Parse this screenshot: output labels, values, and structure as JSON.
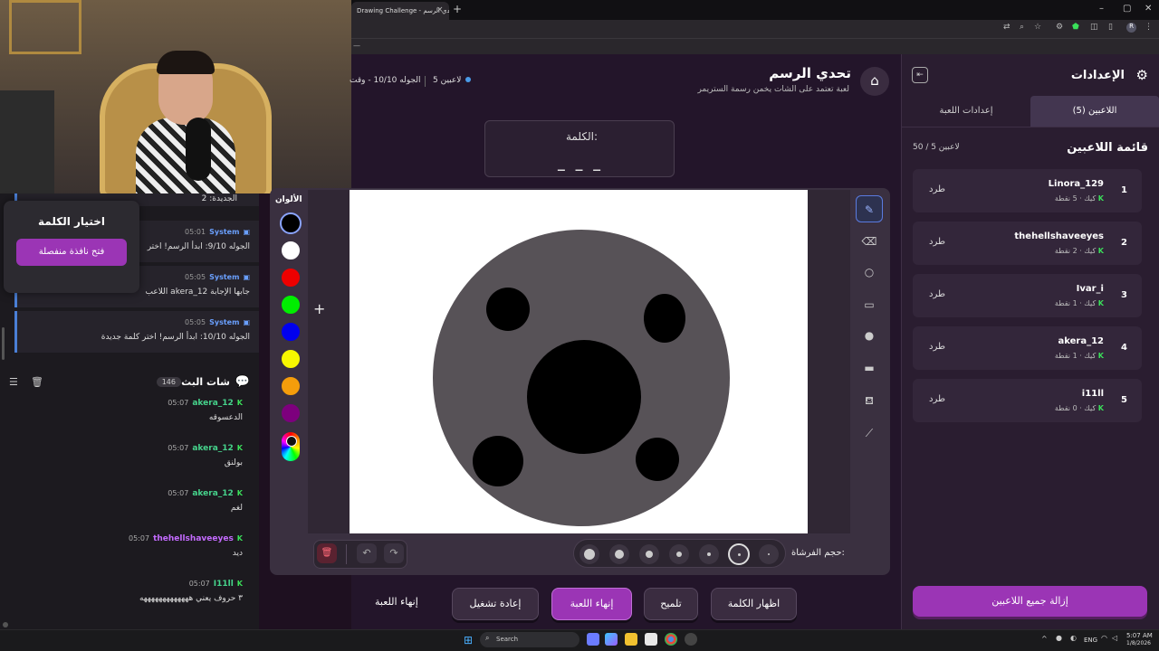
{
  "browser": {
    "tab_title": "Drawing Challenge - تحدي الرسم",
    "tab_close": "×",
    "new_tab": "+",
    "window_controls": [
      "–",
      "▢",
      "✕"
    ],
    "bookmark_text": "—"
  },
  "left_panel": {
    "choose_word": {
      "title": "اختيار الكلمة",
      "button": "فتح نافذة منفصلة"
    },
    "system_top_text": "الجديدة: 2",
    "system_messages": [
      {
        "name": "System",
        "time": "05:01",
        "text": "الجوله 9/10: ابدأ الرسم! اختر"
      },
      {
        "name": "System",
        "time": "05:05",
        "text": "اللاعب akera_12 جابها الإجابة"
      },
      {
        "name": "System",
        "time": "05:05",
        "text": "الجوله 10/10: ابدأ الرسم! اختر كلمة جديدة"
      }
    ],
    "chat": {
      "title": "شات البث",
      "count": "146",
      "messages": [
        {
          "user": "akera_12",
          "time": "05:07",
          "text": "الدعسوقه"
        },
        {
          "user": "akera_12",
          "time": "05:07",
          "text": "بولنق"
        },
        {
          "user": "akera_12",
          "time": "05:07",
          "text": "لغم"
        },
        {
          "user": "thehellshaveeyes",
          "time": "05:07",
          "text": "ديد"
        },
        {
          "user": "I11ll",
          "time": "05:07",
          "text": "٣ حروف يعني هههههههههههههه"
        }
      ]
    }
  },
  "header": {
    "title": "تحدي الرسم",
    "subtitle": "لعبة تعتمد على الشات يخمن رسمة الستريمر",
    "players_status": "5 لاعبين",
    "round_status": "الجوله 10/10 - وقت"
  },
  "word": {
    "label": "الكلمة:",
    "mask": "_ _ _"
  },
  "colors": {
    "label": "الألوان",
    "swatches": [
      "#000000",
      "#ffffff",
      "#ee0000",
      "#00ee00",
      "#0000ee",
      "#f7f700",
      "#f59d0b",
      "#7d007d"
    ]
  },
  "tools": [
    "pen-icon",
    "eraser-icon",
    "circle-outline-icon",
    "rect-outline-icon",
    "circle-fill-icon",
    "rect-fill-icon",
    "fill-bucket-icon",
    "line-icon"
  ],
  "tool_glyphs": [
    "✎",
    "⌫",
    "○",
    "▭",
    "●",
    "▬",
    "⛾",
    "⟋"
  ],
  "brush": {
    "label": "حجم الفرشاة:"
  },
  "canvas_actions": {
    "clear": "🗑",
    "undo": "↶",
    "redo": "↷"
  },
  "actions": {
    "show_word": "اظهار الكلمة",
    "hint": "تلميح",
    "end_game": "إنهاء اللعبة",
    "restart": "إعادة تشغيل",
    "end_game_text": "إنهاء اللعبة"
  },
  "settings": {
    "title": "الإعدادات",
    "tabs": {
      "players": "اللاعبين (5)",
      "game_settings": "إعدادات اللعبة"
    },
    "players_list_title": "قائمة اللاعبين",
    "players_count": "50 / 5 لاعبين",
    "kick_label": "طرد",
    "players": [
      {
        "rank": "1",
        "name": "Linora_129",
        "meta": "كيك · 5 نقطة"
      },
      {
        "rank": "2",
        "name": "thehellshaveeyes",
        "meta": "كيك · 2 نقطة"
      },
      {
        "rank": "3",
        "name": "Ivar_i",
        "meta": "كيك · 1 نقطة"
      },
      {
        "rank": "4",
        "name": "akera_12",
        "meta": "كيك · 1 نقطة"
      },
      {
        "rank": "5",
        "name": "i11ll",
        "meta": "كيك · 0 نقطة"
      }
    ],
    "remove_all": "إزالة جميع اللاعبين"
  },
  "taskbar": {
    "search": "Search",
    "lang": "ENG",
    "time": "5:07 AM",
    "date": "1/8/2026"
  }
}
